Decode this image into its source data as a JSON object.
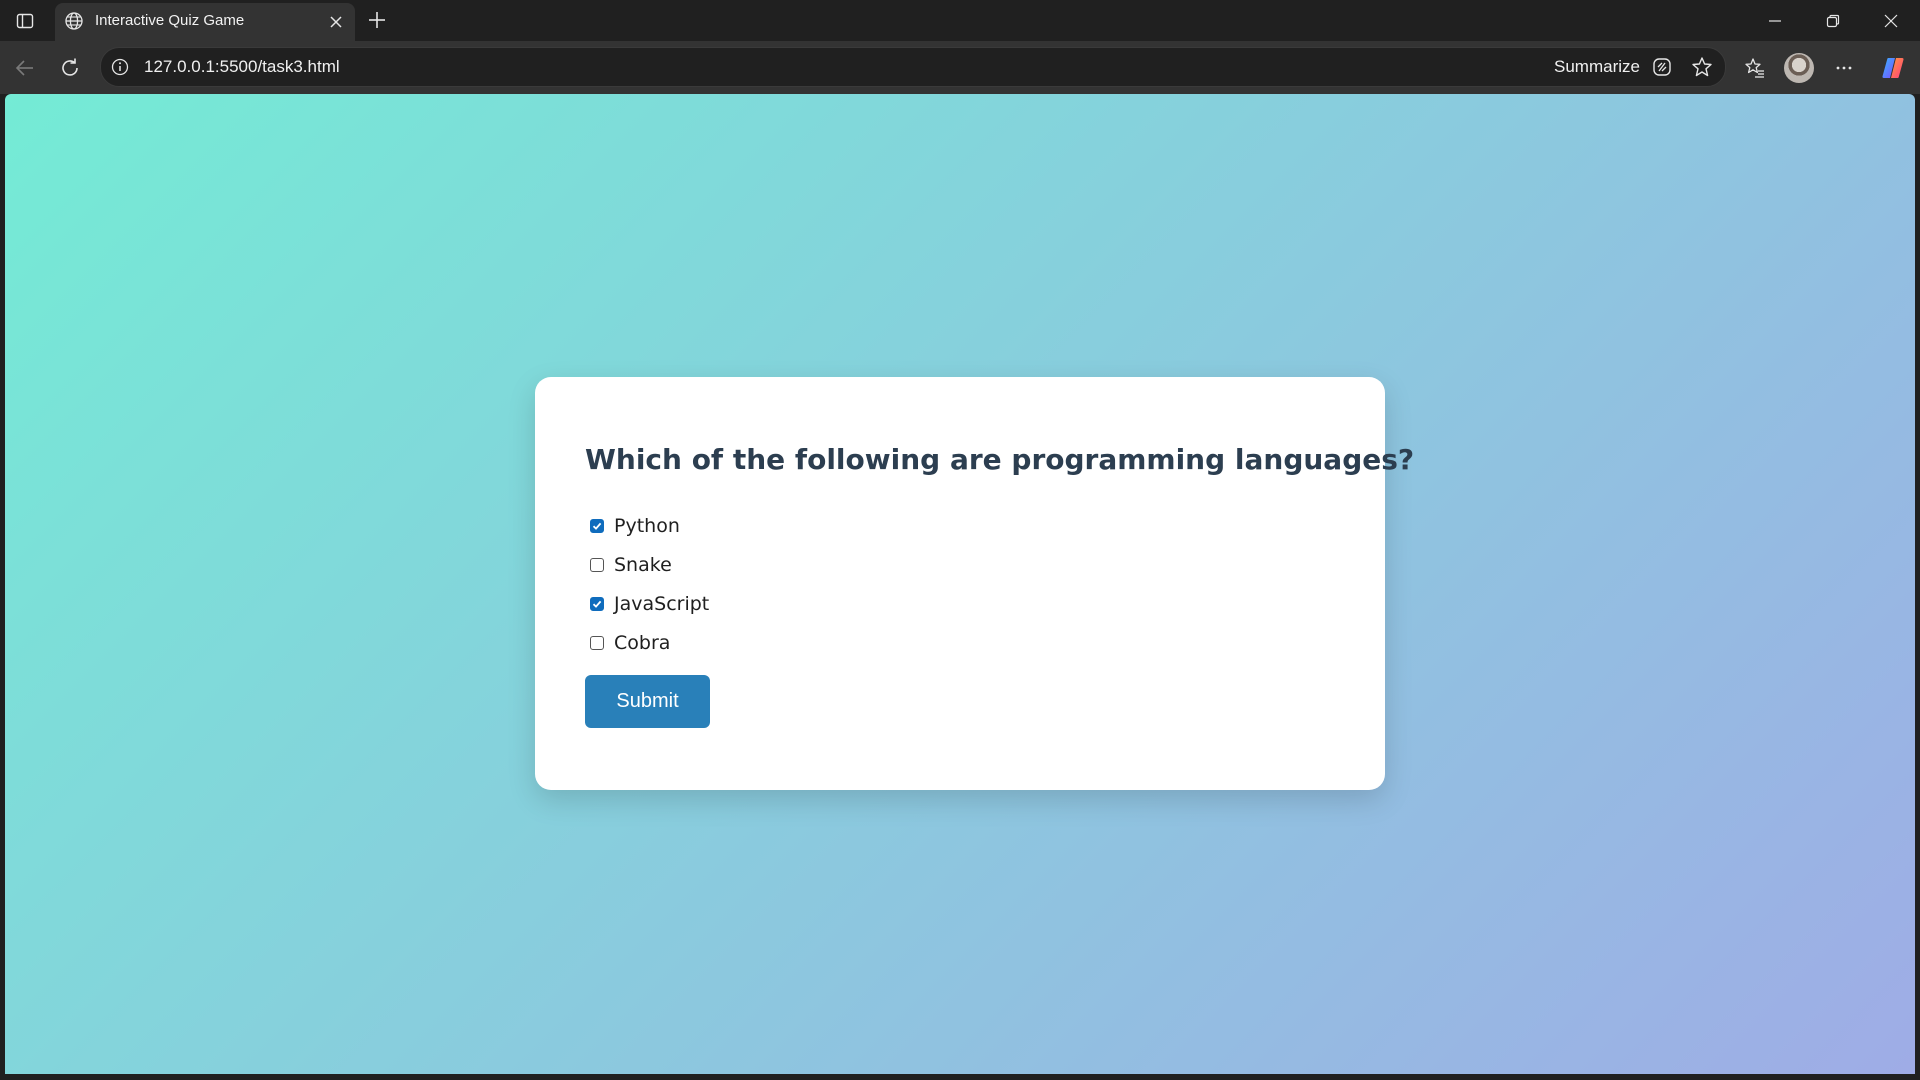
{
  "browser": {
    "tab": {
      "title": "Interactive Quiz Game",
      "favicon": "globe-icon"
    },
    "address_bar": {
      "url": "127.0.0.1:5500/task3.html",
      "summarize_label": "Summarize"
    },
    "icons": {
      "sidebar": "sidebar-icon",
      "close_tab": "close-icon",
      "new_tab": "plus-icon",
      "back": "back-arrow-icon",
      "reload": "reload-icon",
      "site_info": "info-icon",
      "summarize": "summarize-icon",
      "favorite": "star-icon",
      "favorites": "favorites-icon",
      "profile": "avatar",
      "more": "more-icon",
      "copilot": "copilot-icon",
      "minimize": "minimize-icon",
      "restore": "restore-icon",
      "close_window": "close-window-icon"
    }
  },
  "quiz": {
    "question": "Which of the following are programming languages?",
    "options": [
      {
        "label": "Python",
        "checked": true
      },
      {
        "label": "Snake",
        "checked": false
      },
      {
        "label": "JavaScript",
        "checked": true
      },
      {
        "label": "Cobra",
        "checked": false
      }
    ],
    "submit_label": "Submit"
  },
  "colors": {
    "gradient_start": "#74ebd5",
    "gradient_end": "#9face6",
    "heading": "#2c3e50",
    "button": "#2980b9",
    "checkbox_checked": "#0f6cbd"
  }
}
